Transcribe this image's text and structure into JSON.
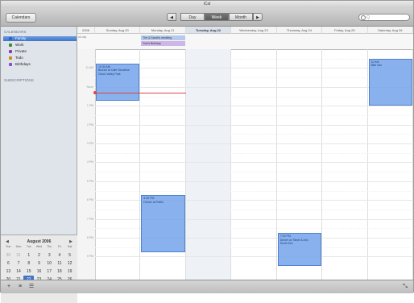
{
  "window": {
    "title": "iCal",
    "lights": [
      "#e05a4e",
      "#e3b43c",
      "#5fb94c"
    ]
  },
  "toolbar": {
    "calendars_btn": "Calendars",
    "prev": "◀",
    "day": "Day",
    "week": "Week",
    "month": "Month",
    "next": "▶",
    "search_placeholder": "Q"
  },
  "sidebar": {
    "group_label": "CALENDARS",
    "items": [
      {
        "label": "Family",
        "color": "#2f64c2",
        "selected": true
      },
      {
        "label": "Work",
        "color": "#3a8e2e",
        "selected": false
      },
      {
        "label": "Private",
        "color": "#8a3cc0",
        "selected": false
      },
      {
        "label": "Todo",
        "color": "#d38a15",
        "selected": false
      },
      {
        "label": "Birthdays",
        "color": "#8a50c8",
        "selected": false
      }
    ],
    "subscriptions_label": "SUBSCRIPTIONS"
  },
  "minical": {
    "title": "August 2006",
    "prev": "◀",
    "next": "▶",
    "day_headers": [
      "Sun",
      "Mon",
      "Tue",
      "Wed",
      "Thu",
      "Fri",
      "Sat"
    ],
    "weeks": [
      [
        "30",
        "31",
        "1",
        "2",
        "3",
        "4",
        "5"
      ],
      [
        "6",
        "7",
        "8",
        "9",
        "10",
        "11",
        "12"
      ],
      [
        "13",
        "14",
        "15",
        "16",
        "17",
        "18",
        "19"
      ],
      [
        "20",
        "21",
        "22",
        "23",
        "24",
        "25",
        "26"
      ],
      [
        "27",
        "28",
        "29",
        "30",
        "31",
        "1",
        "2"
      ]
    ],
    "today": "22"
  },
  "week": {
    "year_label": "2006",
    "allday_label": "all-day",
    "days": [
      {
        "label": "Sunday, Aug 20",
        "today": false
      },
      {
        "label": "Monday, Aug 21",
        "today": false
      },
      {
        "label": "Tuesday, Aug 22",
        "today": true
      },
      {
        "label": "Wednesday, Aug 23",
        "today": false
      },
      {
        "label": "Thursday, Aug 24",
        "today": false
      },
      {
        "label": "Friday, Aug 25",
        "today": false
      },
      {
        "label": "Saturday, Aug 26",
        "today": false
      }
    ],
    "hours": [
      "11 AM",
      "Noon",
      "1 PM",
      "2 PM",
      "3 PM",
      "4 PM",
      "5 PM",
      "6 PM",
      "7 PM",
      "8 PM",
      "9 PM"
    ],
    "allday_events": [
      {
        "day": 1,
        "row": 0,
        "title": "Tim & Sarah's wedding",
        "color": "#b4c9ec"
      },
      {
        "day": 1,
        "row": 1,
        "title": "Sue's Birthday",
        "color": "#cdb7e8"
      }
    ],
    "events": [
      {
        "day": 0,
        "start": 10.75,
        "end": 12.75,
        "time": "10:30 AM",
        "title": "Brunch at Cafe Stoneline",
        "note": "Cloud Valley Park"
      },
      {
        "day": 6,
        "start": 10.5,
        "end": 13.0,
        "time": "10 AM",
        "title": "Bike ride"
      },
      {
        "day": 1,
        "start": 17.75,
        "end": 20.75,
        "time": "5:30 PM",
        "title": "Dinner at Patti's"
      },
      {
        "day": 4,
        "start": 19.75,
        "end": 21.5,
        "time": "7:30 PM",
        "title": "Dinner w/ Steve & Ann",
        "note": "Sushi Zen"
      }
    ],
    "now_hour": 12.3
  },
  "bottom": {
    "add": "+",
    "show": "≡",
    "list": "☰",
    "resize": "⤡"
  }
}
